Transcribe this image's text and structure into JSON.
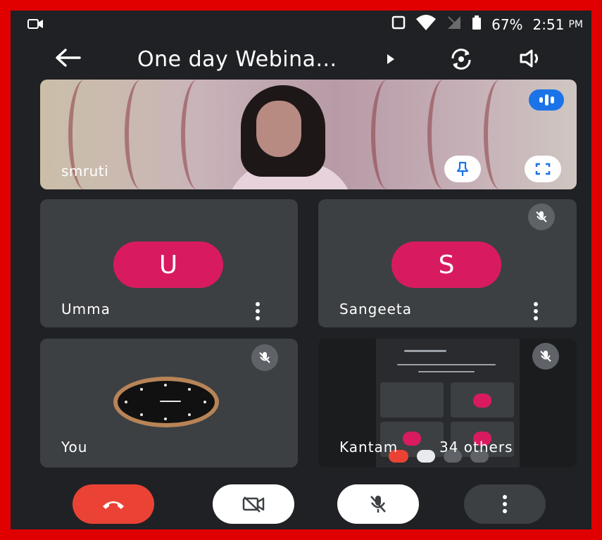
{
  "status_bar": {
    "battery": "67%",
    "time": "2:51",
    "ampm": "PM",
    "icons": [
      "video-record-icon",
      "square-icon",
      "wifi-icon",
      "no-sim-icon",
      "battery-icon"
    ]
  },
  "header": {
    "title": "One day Webina...",
    "icons": [
      "back-arrow-icon",
      "play-arrow-icon",
      "switch-camera-icon",
      "speaker-icon"
    ]
  },
  "participants": {
    "main": {
      "name": "smruti"
    },
    "umma": {
      "name": "Umma",
      "initial": "U"
    },
    "sangeeta": {
      "name": "Sangeeta",
      "initial": "S"
    },
    "you": {
      "name": "You"
    },
    "kantam": {
      "name": "Kantam",
      "others": "34 others"
    }
  },
  "colors": {
    "avatar": "#d81b60",
    "end_call": "#ea4335",
    "tile_bg": "#3c4043",
    "screen_bg": "#202124",
    "accent": "#1a73e8"
  },
  "controls": {
    "icons": [
      "end-call-icon",
      "camera-off-icon",
      "mic-off-icon",
      "more-vertical-icon"
    ]
  }
}
